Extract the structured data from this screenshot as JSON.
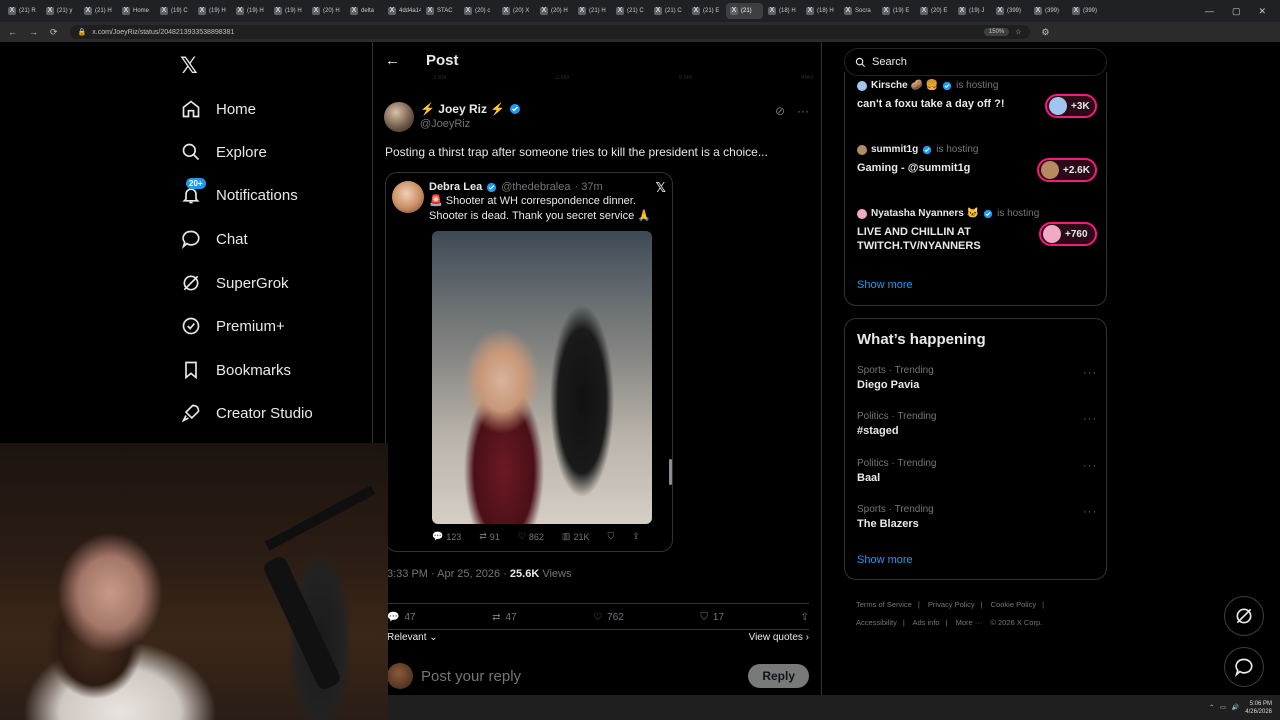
{
  "browser": {
    "tabs": [
      "(21) R",
      "(21) y",
      "(21) H",
      "Home",
      "(19) C",
      "(19) H",
      "(19) H",
      "(19) H",
      "(20) H",
      "delta",
      "4dd4a14",
      "STAC",
      "(20) c",
      "(20) X",
      "(20) H",
      "(21) H",
      "(21) C",
      "(21) C",
      "(21) E",
      "(21)",
      "(18) H",
      "(18) H",
      "Socra",
      "(19) E",
      "(20) E",
      "(19) J",
      "(399)",
      "(399)",
      "(399)"
    ],
    "active_tab_index": 19,
    "url": "x.com/JoeyRiz/status/2048213933538898381",
    "zoom": "150%"
  },
  "nav": {
    "items": [
      {
        "label": "Home",
        "icon": "home-icon"
      },
      {
        "label": "Explore",
        "icon": "search-icon"
      },
      {
        "label": "Notifications",
        "icon": "bell-icon",
        "badge": "20+"
      },
      {
        "label": "Chat",
        "icon": "chat-icon"
      },
      {
        "label": "SuperGrok",
        "icon": "grok-icon"
      },
      {
        "label": "Premium+",
        "icon": "verified-icon"
      },
      {
        "label": "Bookmarks",
        "icon": "bookmark-icon"
      },
      {
        "label": "Creator Studio",
        "icon": "rocket-icon"
      }
    ]
  },
  "post": {
    "header_title": "Post",
    "ghost_row": [
      "2.6M",
      "2.6M",
      "9.5M",
      "46M"
    ],
    "author_name": "⚡ Joey Riz ⚡",
    "author_handle": "@JoeyRiz",
    "text": "Posting a thirst trap after someone tries to kill the president is a choice...",
    "quote": {
      "name": "Debra Lea",
      "handle": "@thedebralea",
      "time": "· 37m",
      "text": "🚨 Shooter at WH correspondence dinner. Shooter is dead. Thank you secret service 🙏",
      "stats": {
        "replies": "123",
        "reposts": "91",
        "likes": "862",
        "views": "21K"
      }
    },
    "time": "3:33 PM · Apr 25, 2026 ·",
    "views_count": "25.6K",
    "views_label": "Views",
    "stats": {
      "replies": "47",
      "reposts": "47",
      "likes": "762",
      "bookmarks": "17"
    },
    "sort_label": "Relevant",
    "view_quotes": "View quotes",
    "reply_placeholder": "Post your reply",
    "reply_button": "Reply"
  },
  "sidebar": {
    "search_placeholder": "Search",
    "spaces": [
      {
        "host": "Kirsche 🥔 🍔",
        "status": "is hosting",
        "title": "can't a foxu take a day off ?!",
        "count": "+3K",
        "color": "#9fc6ef"
      },
      {
        "host": "summit1g",
        "status": "is hosting",
        "title": "Gaming - @summit1g",
        "count": "+2.6K",
        "color": "#b58b5f"
      },
      {
        "host": "Nyatasha Nyanners 🐱",
        "status": "is hosting",
        "title": "LIVE AND CHILLIN AT TWITCH.TV/NYANNERS",
        "count": "+760",
        "color": "#f2a9c4"
      }
    ],
    "show_more": "Show more",
    "trending_title": "What’s happening",
    "trends": [
      {
        "category": "Sports · Trending",
        "name": "Diego Pavia"
      },
      {
        "category": "Politics · Trending",
        "name": "#staged"
      },
      {
        "category": "Politics · Trending",
        "name": "Baal"
      },
      {
        "category": "Sports · Trending",
        "name": "The Blazers"
      }
    ],
    "trends_show_more": "Show more",
    "footer": [
      "Terms of Service",
      "|",
      "Privacy Policy",
      "|",
      "Cookie Policy",
      "|",
      "Accessibility",
      "|",
      "Ads info",
      "|",
      "More ···",
      "© 2026 X Corp."
    ]
  },
  "taskbar": {
    "time": "5:06 PM",
    "date": "4/26/2026"
  },
  "colors": {
    "accent": "#1d9bf0",
    "live": "#f91880",
    "background": "#000000",
    "border": "#2f3336"
  }
}
